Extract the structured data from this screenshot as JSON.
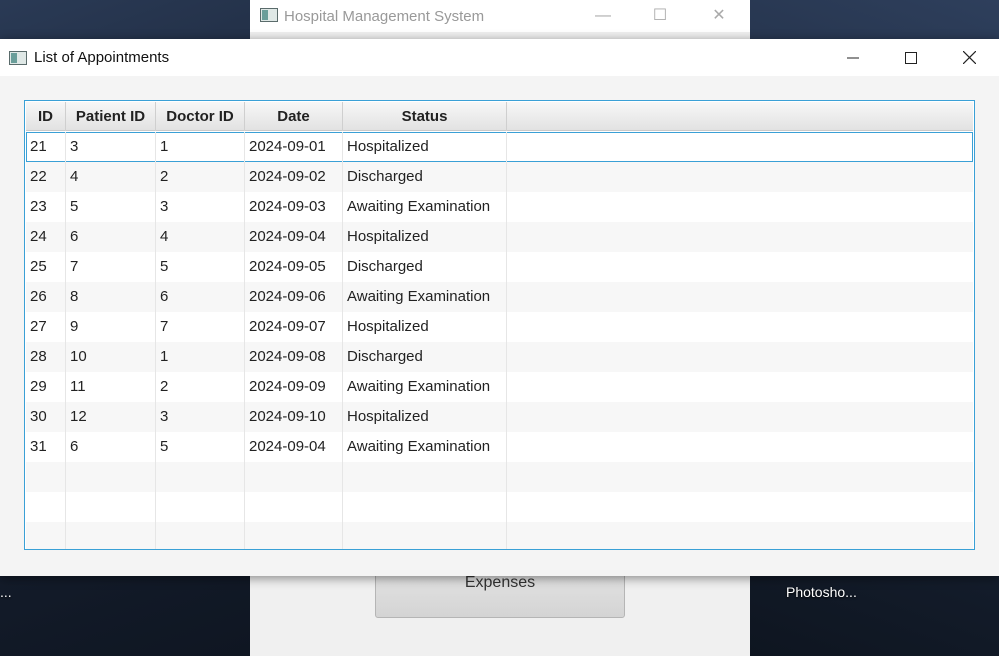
{
  "background_window": {
    "title": "Hospital Management System",
    "button_label": "Expenses",
    "desktop_label_left": "...",
    "desktop_label_right": "Photosho..."
  },
  "dialog": {
    "title": "List of Appointments",
    "controls": {
      "minimize": "minimize-icon",
      "maximize": "maximize-icon",
      "close": "close-icon"
    },
    "table": {
      "columns": [
        "ID",
        "Patient ID",
        "Doctor ID",
        "Date",
        "Status"
      ],
      "rows": [
        [
          "21",
          "3",
          "1",
          "2024-09-01",
          "Hospitalized"
        ],
        [
          "22",
          "4",
          "2",
          "2024-09-02",
          "Discharged"
        ],
        [
          "23",
          "5",
          "3",
          "2024-09-03",
          "Awaiting Examination"
        ],
        [
          "24",
          "6",
          "4",
          "2024-09-04",
          "Hospitalized"
        ],
        [
          "25",
          "7",
          "5",
          "2024-09-05",
          "Discharged"
        ],
        [
          "26",
          "8",
          "6",
          "2024-09-06",
          "Awaiting Examination"
        ],
        [
          "27",
          "9",
          "7",
          "2024-09-07",
          "Hospitalized"
        ],
        [
          "28",
          "10",
          "1",
          "2024-09-08",
          "Discharged"
        ],
        [
          "29",
          "11",
          "2",
          "2024-09-09",
          "Awaiting Examination"
        ],
        [
          "30",
          "12",
          "3",
          "2024-09-10",
          "Hospitalized"
        ],
        [
          "31",
          "6",
          "5",
          "2024-09-04",
          "Awaiting Examination"
        ]
      ],
      "empty_rows": 3,
      "selected_row": 0
    }
  },
  "colors": {
    "accent": "#3aa0d6",
    "header_bg": "#e9e9e9",
    "stripe": "#f7f7f7"
  }
}
